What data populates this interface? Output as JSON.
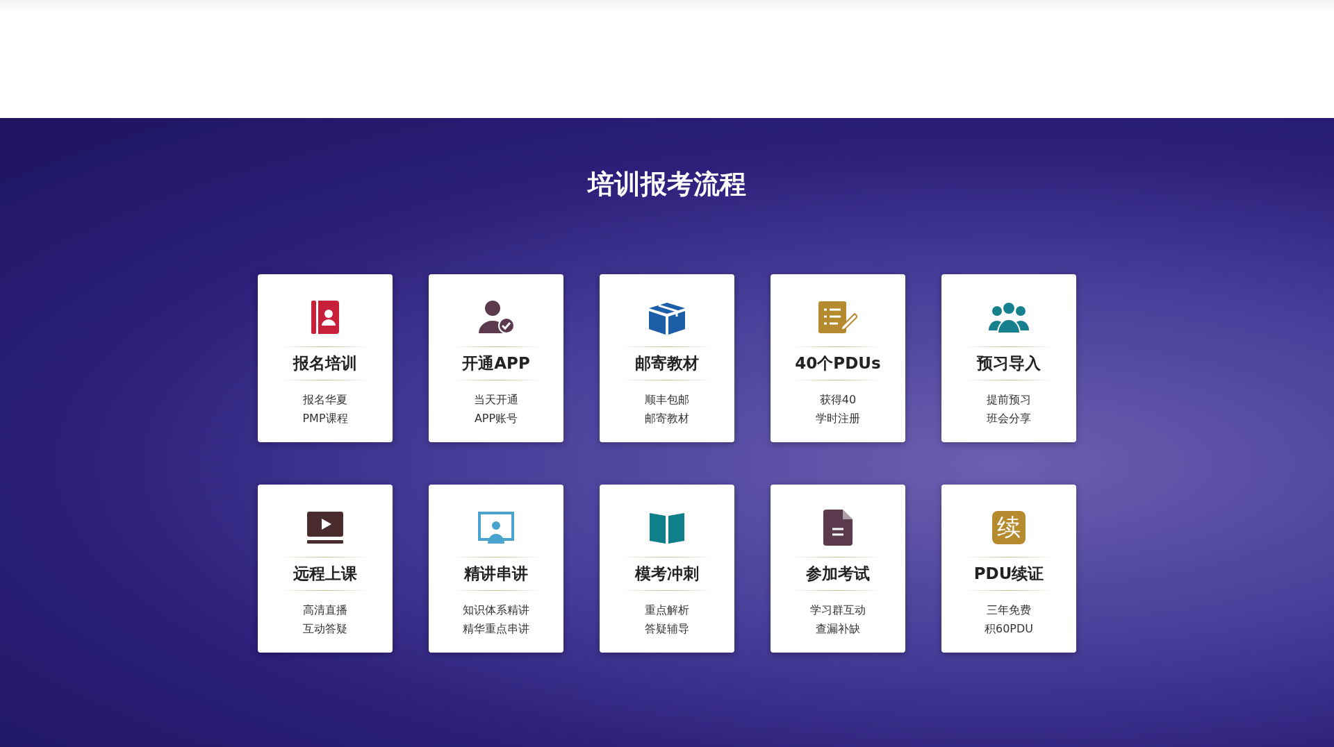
{
  "section_title": "培训报考流程",
  "steps": [
    {
      "kind": "contact-card",
      "title": "报名培训",
      "lines": [
        "报名华夏",
        "PMP课程"
      ]
    },
    {
      "kind": "user-check",
      "title": "开通APP",
      "lines": [
        "当天开通",
        "APP账号"
      ]
    },
    {
      "kind": "box",
      "title": "邮寄教材",
      "lines": [
        "顺丰包邮",
        "邮寄教材"
      ]
    },
    {
      "kind": "checklist",
      "title": "40个PDUs",
      "lines": [
        "获得40",
        "学时注册"
      ]
    },
    {
      "kind": "group",
      "title": "预习导入",
      "lines": [
        "提前预习",
        "班会分享"
      ]
    },
    {
      "kind": "video",
      "title": "远程上课",
      "lines": [
        "高清直播",
        "互动答疑"
      ]
    },
    {
      "kind": "presenter",
      "title": "精讲串讲",
      "lines": [
        "知识体系精讲",
        "精华重点串讲"
      ]
    },
    {
      "kind": "book",
      "title": "模考冲刺",
      "lines": [
        "重点解析",
        "答疑辅导"
      ]
    },
    {
      "kind": "document",
      "title": "参加考试",
      "lines": [
        "学习群互动",
        "查漏补缺"
      ]
    },
    {
      "kind": "glyph-badge",
      "icon_text": "续",
      "title": "PDU续证",
      "lines": [
        "三年免费",
        "积60PDU"
      ]
    }
  ]
}
